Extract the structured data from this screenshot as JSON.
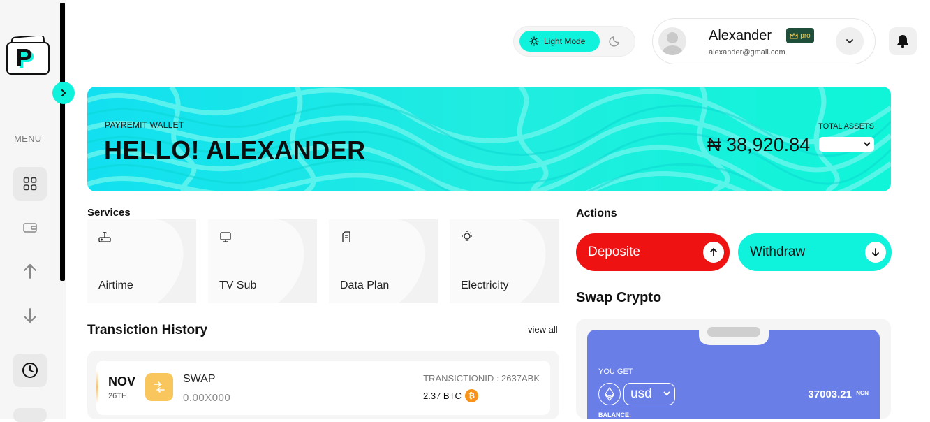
{
  "sidebar": {
    "menu_label": "MENU",
    "items": [
      {
        "icon": "grid-icon",
        "active": true
      },
      {
        "icon": "wallet-icon",
        "active": false
      },
      {
        "icon": "arrow-up-icon",
        "active": false
      },
      {
        "icon": "arrow-down-icon",
        "active": false
      },
      {
        "icon": "clock-icon",
        "active": true
      }
    ]
  },
  "theme": {
    "light_label": "Light Mode"
  },
  "profile": {
    "name": "Alexander",
    "email": "alexander@gmail.com",
    "badge": "pro"
  },
  "banner": {
    "subtitle": "PAYREMIT WALLET",
    "title": "HELLO! ALEXANDER",
    "assets_label": "TOTAL ASSETS",
    "assets_amount": "₦ 38,920.84"
  },
  "services": {
    "title": "Services",
    "items": [
      {
        "label": "Airtime",
        "icon": "router-icon"
      },
      {
        "label": "TV Sub",
        "icon": "monitor-icon"
      },
      {
        "label": "Data Plan",
        "icon": "sim-icon"
      },
      {
        "label": "Electricity",
        "icon": "bulb-icon"
      }
    ]
  },
  "actions": {
    "title": "Actions",
    "deposit": "Deposite",
    "withdraw": "Withdraw"
  },
  "history": {
    "title": "Transiction History",
    "view_all": "view all",
    "rows": [
      {
        "month": "NOV",
        "day": "26TH",
        "type": "SWAP",
        "amount": "0.00X000",
        "txid": "TRANSICTIONID : 2637ABK",
        "crypto": "2.37 BTC"
      }
    ]
  },
  "swap": {
    "title": "Swap Crypto",
    "you_get": "YOU GET",
    "currency": "usd",
    "amount": "37003.21",
    "unit": "NGN",
    "balance_label": "BALANCE:"
  },
  "colors": {
    "accent": "#0ff2dc",
    "deposit": "#ee1212",
    "swap_card": "#6a7ee8",
    "banner": "#19e8e0"
  }
}
